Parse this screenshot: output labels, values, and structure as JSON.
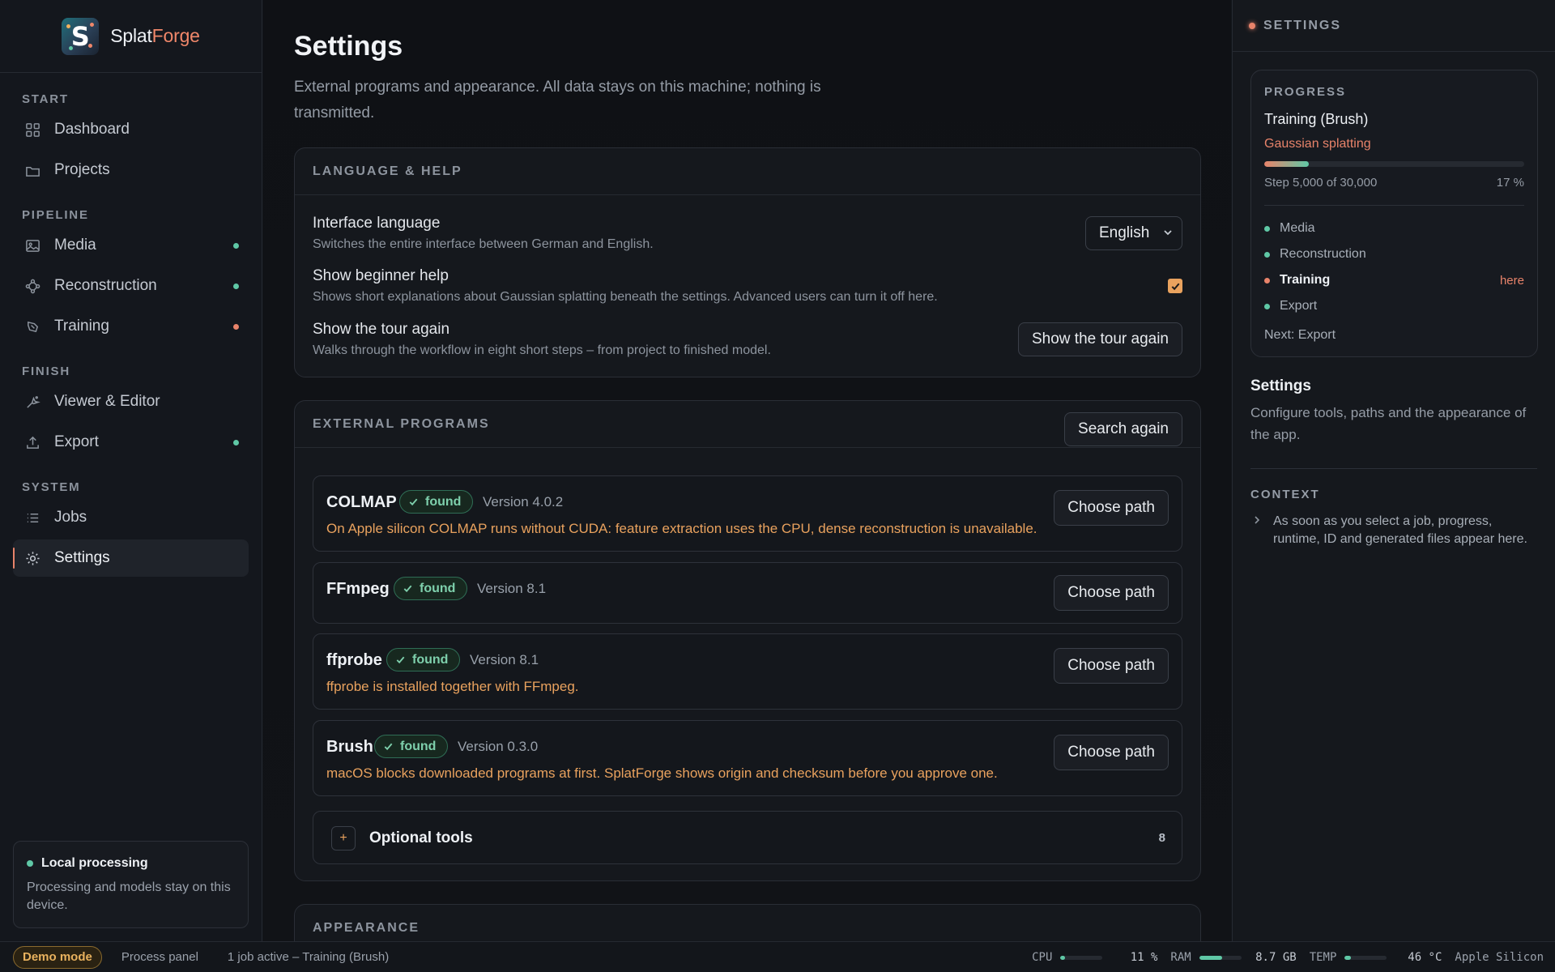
{
  "brand": {
    "name_a": "Splat",
    "name_b": "Forge",
    "logo_letter": "S",
    "accent": "#f0876a"
  },
  "sidebar": {
    "sections": [
      {
        "label": "START",
        "items": [
          {
            "label": "Dashboard",
            "icon": "grid-icon",
            "status": null
          },
          {
            "label": "Projects",
            "icon": "folder-icon",
            "status": null
          }
        ]
      },
      {
        "label": "PIPELINE",
        "items": [
          {
            "label": "Media",
            "icon": "image-icon",
            "status": "#5fc8a6"
          },
          {
            "label": "Reconstruction",
            "icon": "nodes-icon",
            "status": "#5fc8a6"
          },
          {
            "label": "Training",
            "icon": "training-icon",
            "status": "#e8836a"
          }
        ]
      },
      {
        "label": "FINISH",
        "items": [
          {
            "label": "Viewer & Editor",
            "icon": "editor-icon",
            "status": null
          },
          {
            "label": "Export",
            "icon": "export-icon",
            "status": "#5fc8a6"
          }
        ]
      },
      {
        "label": "SYSTEM",
        "items": [
          {
            "label": "Jobs",
            "icon": "list-icon",
            "status": null
          },
          {
            "label": "Settings",
            "icon": "gear-icon",
            "status": null,
            "active": true
          }
        ]
      }
    ],
    "local": {
      "title": "Local processing",
      "text": "Processing and models stay on this device."
    }
  },
  "main": {
    "title": "Settings",
    "subtitle": "External programs and appearance. All data stays on this machine; nothing is transmitted.",
    "language_help": {
      "header": "LANGUAGE & HELP",
      "language": {
        "title": "Interface language",
        "desc": "Switches the entire interface between German and English.",
        "value": "English"
      },
      "beginner": {
        "title": "Show beginner help",
        "desc": "Shows short explanations about Gaussian splatting beneath the settings. Advanced users can turn it off here.",
        "checked": true
      },
      "tour": {
        "title": "Show the tour again",
        "desc": "Walks through the workflow in eight short steps – from project to finished model.",
        "button": "Show the tour again"
      }
    },
    "external": {
      "header": "EXTERNAL PROGRAMS",
      "search_button": "Search again",
      "programs": [
        {
          "name": "COLMAP",
          "status": "found",
          "version": "Version 4.0.2",
          "note": "On Apple silicon COLMAP runs without CUDA: feature extraction uses the CPU, dense reconstruction is unavailable.",
          "button": "Choose path"
        },
        {
          "name": "FFmpeg",
          "status": "found",
          "version": "Version 8.1",
          "note": "",
          "button": "Choose path"
        },
        {
          "name": "ffprobe",
          "status": "found",
          "version": "Version 8.1",
          "note": "ffprobe is installed together with FFmpeg.",
          "button": "Choose path"
        },
        {
          "name": "Brush",
          "status": "found",
          "version": "Version 0.3.0",
          "note": "macOS blocks downloaded programs at first. SplatForge shows origin and checksum before you approve one.",
          "button": "Choose path"
        }
      ],
      "optional": {
        "label": "Optional tools",
        "count": "8",
        "icon": "+"
      }
    },
    "appearance": {
      "header": "APPEARANCE"
    }
  },
  "right": {
    "header": "SETTINGS",
    "progress": {
      "label": "PROGRESS",
      "job": "Training (Brush)",
      "sub": "Gaussian splatting",
      "fraction": 0.17,
      "step": "Step 5,000 of 30,000",
      "pct": "17 %",
      "stages": [
        {
          "label": "Media",
          "color": "#5fc8a6",
          "current": false,
          "tag": ""
        },
        {
          "label": "Reconstruction",
          "color": "#5fc8a6",
          "current": false,
          "tag": ""
        },
        {
          "label": "Training",
          "color": "#e8836a",
          "current": true,
          "tag": "here"
        },
        {
          "label": "Export",
          "color": "#5fc8a6",
          "current": false,
          "tag": ""
        }
      ],
      "next": "Next: Export"
    },
    "title": "Settings",
    "desc": "Configure tools, paths and the appearance of the app.",
    "context_label": "CONTEXT",
    "context_text": "As soon as you select a job, progress, runtime, ID and generated files appear here."
  },
  "statusbar": {
    "demo": "Demo mode",
    "panel": "Process panel",
    "job": "1 job active – Training (Brush)",
    "cpu": {
      "label": "CPU",
      "value": "11 %",
      "fraction": 0.11
    },
    "ram": {
      "label": "RAM",
      "value": "8.7 GB",
      "fraction": 0.54
    },
    "temp": {
      "label": "TEMP",
      "value": "46 °C",
      "fraction": 0.15
    },
    "chip": "Apple Silicon"
  }
}
